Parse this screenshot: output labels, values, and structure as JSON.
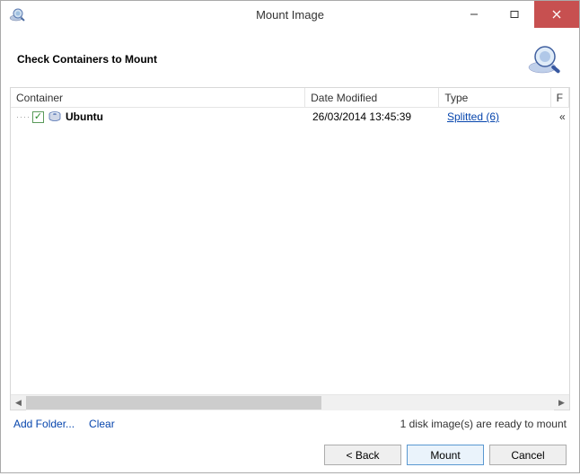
{
  "window": {
    "title": "Mount Image"
  },
  "header": {
    "title": "Check Containers to Mount"
  },
  "columns": {
    "container": "Container",
    "date": "Date Modified",
    "type": "Type",
    "f": "F"
  },
  "rows": [
    {
      "checked": true,
      "name": "Ubuntu",
      "date": "26/03/2014 13:45:39",
      "type": "Splitted (6)",
      "f": "«"
    }
  ],
  "links": {
    "add_folder": "Add Folder...",
    "clear": "Clear"
  },
  "status": "1 disk image(s) are ready to mount",
  "buttons": {
    "back": "< Back",
    "mount": "Mount",
    "cancel": "Cancel"
  }
}
